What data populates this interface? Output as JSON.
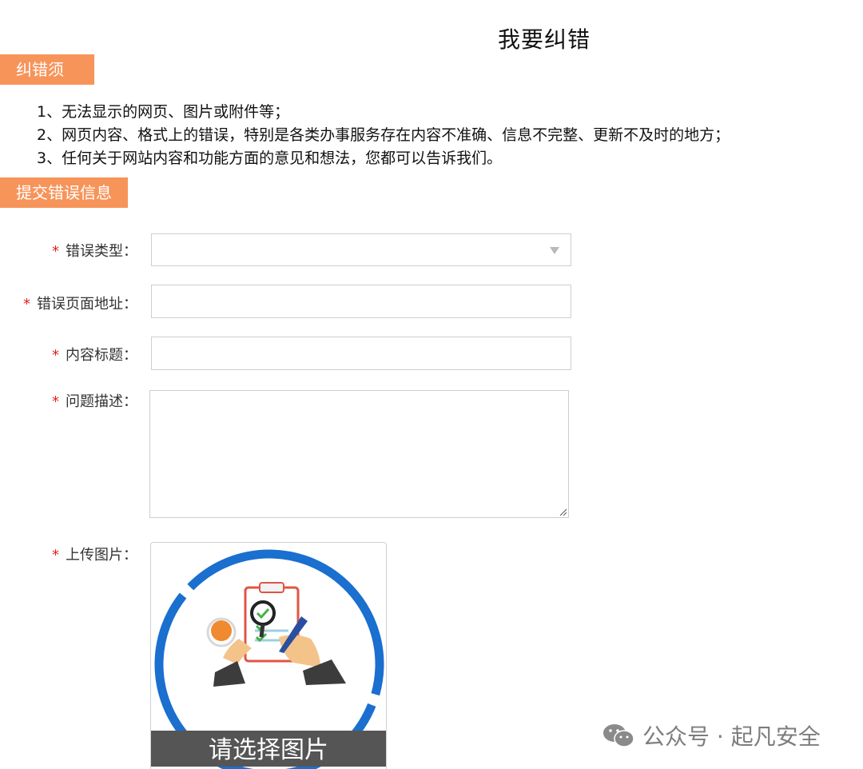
{
  "page": {
    "title": "我要纠错"
  },
  "notice": {
    "tag": "纠错须知",
    "items": [
      "1、无法显示的网页、图片或附件等；",
      "2、网页内容、格式上的错误，特别是各类办事服务存在内容不准确、信息不完整、更新不及时的地方；",
      "3、任何关于网站内容和功能方面的意见和想法，您都可以告诉我们。"
    ]
  },
  "form": {
    "tag": "提交错误信息",
    "required_mark": "*",
    "error_type_label": "错误类型：",
    "error_url_label": "错误页面地址：",
    "content_title_label": "内容标题：",
    "description_label": "问题描述：",
    "upload_label": "上传图片：",
    "error_type_value": "",
    "error_url_value": "",
    "content_title_value": "",
    "description_value": "",
    "upload_button": "请选择图片"
  },
  "watermark": {
    "text": "公众号 · 起凡安全"
  },
  "colors": {
    "tag_bg": "#f7945a",
    "required": "#e02020",
    "upload_ring": "#1a6fcf",
    "upload_bar": "#555555"
  }
}
